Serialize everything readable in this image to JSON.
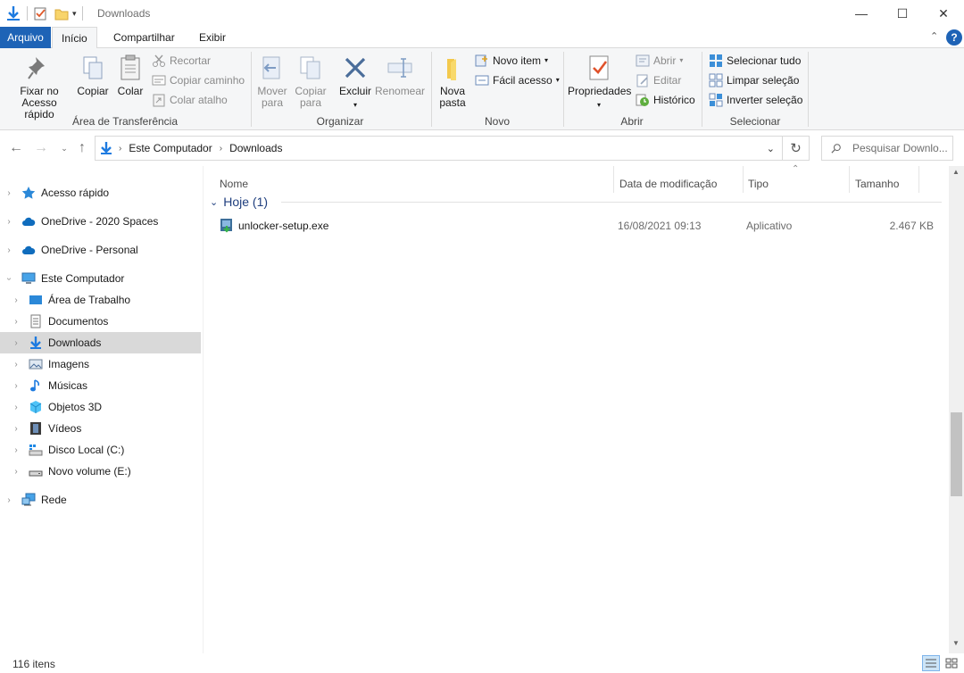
{
  "window": {
    "title": "Downloads",
    "controls": {
      "minimize": "—",
      "maximize": "☐",
      "close": "✕"
    }
  },
  "ribbon_tabs": [
    "Arquivo",
    "Início",
    "Compartilhar",
    "Exibir"
  ],
  "ribbon": {
    "clipboard": {
      "label": "Área de Transferência",
      "pin": "Fixar no Acesso rápido",
      "copy": "Copiar",
      "paste": "Colar",
      "cut": "Recortar",
      "copy_path": "Copiar caminho",
      "paste_shortcut": "Colar atalho"
    },
    "organize": {
      "label": "Organizar",
      "move_to": "Mover para",
      "copy_to": "Copiar para",
      "delete": "Excluir",
      "rename": "Renomear"
    },
    "new": {
      "label": "Novo",
      "new_folder": "Nova pasta",
      "new_item": "Novo item",
      "easy_access": "Fácil acesso"
    },
    "open": {
      "label": "Abrir",
      "properties": "Propriedades",
      "open": "Abrir",
      "edit": "Editar",
      "history": "Histórico"
    },
    "select": {
      "label": "Selecionar",
      "select_all": "Selecionar tudo",
      "select_none": "Limpar seleção",
      "invert": "Inverter seleção"
    }
  },
  "address": {
    "path": [
      "Este Computador",
      "Downloads"
    ],
    "search_placeholder": "Pesquisar Downlo..."
  },
  "navpane": {
    "items": [
      {
        "label": "Acesso rápido",
        "icon": "star-icon",
        "level": 0,
        "selected": false
      },
      {
        "label": "OneDrive - 2020 Spaces",
        "icon": "cloud-icon",
        "level": 0,
        "selected": false
      },
      {
        "label": "OneDrive - Personal",
        "icon": "cloud-icon",
        "level": 0,
        "selected": false
      },
      {
        "label": "Este Computador",
        "icon": "computer-icon",
        "level": 0,
        "selected": false
      },
      {
        "label": "Área de Trabalho",
        "icon": "desktop-icon",
        "level": 1,
        "selected": false
      },
      {
        "label": "Documentos",
        "icon": "documents-icon",
        "level": 1,
        "selected": false
      },
      {
        "label": "Downloads",
        "icon": "download-icon",
        "level": 1,
        "selected": true
      },
      {
        "label": "Imagens",
        "icon": "pictures-icon",
        "level": 1,
        "selected": false
      },
      {
        "label": "Músicas",
        "icon": "music-icon",
        "level": 1,
        "selected": false
      },
      {
        "label": "Objetos 3D",
        "icon": "cube-icon",
        "level": 1,
        "selected": false
      },
      {
        "label": "Vídeos",
        "icon": "video-icon",
        "level": 1,
        "selected": false
      },
      {
        "label": "Disco Local (C:)",
        "icon": "drive-icon",
        "level": 1,
        "selected": false
      },
      {
        "label": "Novo volume (E:)",
        "icon": "drive-icon",
        "level": 1,
        "selected": false
      },
      {
        "label": "Rede",
        "icon": "network-icon",
        "level": 0,
        "selected": false
      }
    ]
  },
  "filelist": {
    "columns": [
      "Nome",
      "Data de modificação",
      "Tipo",
      "Tamanho"
    ],
    "group": "Hoje (1)",
    "files": [
      {
        "name": "unlocker-setup.exe",
        "modified": "16/08/2021 09:13",
        "type": "Aplicativo",
        "size": "2.467 KB"
      }
    ]
  },
  "status": {
    "count": "116 itens"
  },
  "colors": {
    "accent": "#1e63b6",
    "selected": "#d9d9d9",
    "group_text": "#1e3e7e"
  }
}
